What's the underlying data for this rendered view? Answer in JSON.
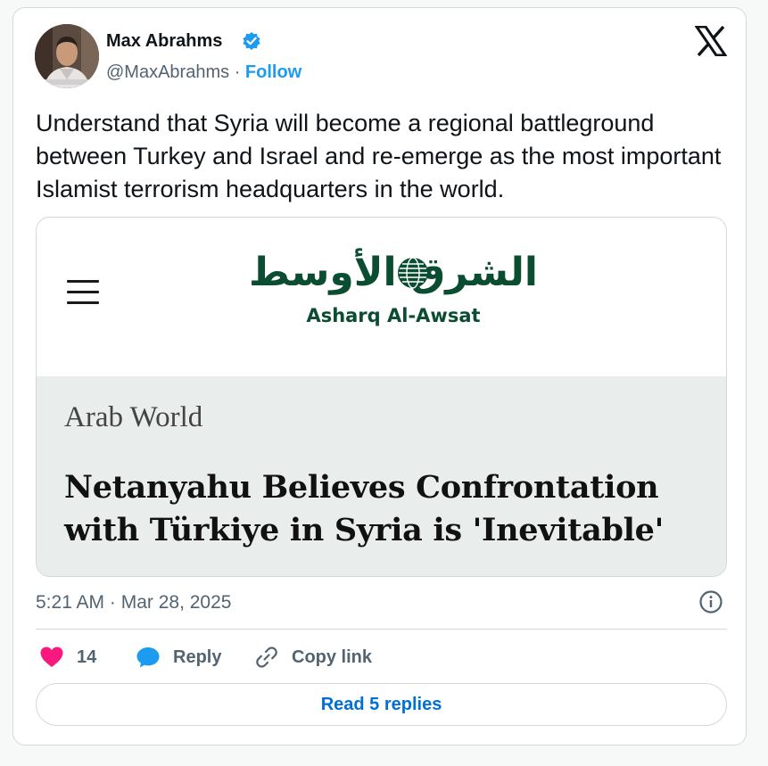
{
  "author": {
    "name": "Max Abrahms",
    "handle": "@MaxAbrahms",
    "separator": "·",
    "follow_label": "Follow",
    "verified_color": "#1d9bf0"
  },
  "tweet": {
    "text": "Understand that Syria will become a regional battleground between Turkey and Israel and re-emerge as the most important Islamist terrorism headquarters in the world."
  },
  "embed": {
    "logo_arabic": "الشرق الأوسط",
    "logo_latin": "Asharq Al-Awsat",
    "section": "Arab World",
    "headline": "Netanyahu Believes Confrontation with Türkiye in Syria is 'Inevitable'",
    "brand_color": "#0a4d31"
  },
  "meta": {
    "timestamp": "5:21 AM · Mar 28, 2025"
  },
  "actions": {
    "like_count": "14",
    "reply_label": "Reply",
    "copy_label": "Copy link",
    "read_replies_label": "Read 5 replies"
  },
  "icons": {
    "like": "heart-icon",
    "reply": "speech-bubble-icon",
    "copy": "link-icon",
    "info": "info-icon",
    "platform": "x-logo-icon",
    "menu": "hamburger-menu-icon"
  },
  "colors": {
    "like": "#f91880",
    "reply": "#1d9bf0",
    "link": "#006fd6",
    "muted": "#536471"
  }
}
